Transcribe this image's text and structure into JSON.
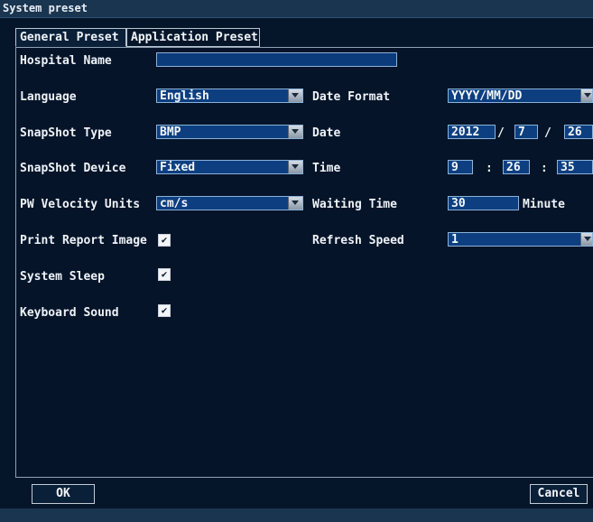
{
  "window": {
    "title": "System preset"
  },
  "tabs": [
    {
      "label": "General Preset",
      "active": true
    },
    {
      "label": "Application Preset",
      "active": false
    }
  ],
  "left": {
    "hospital_name_label": "Hospital Name",
    "hospital_name_value": "",
    "language_label": "Language",
    "language_value": "English",
    "snapshot_type_label": "SnapShot Type",
    "snapshot_type_value": "BMP",
    "snapshot_device_label": "SnapShot Device",
    "snapshot_device_value": "Fixed",
    "pw_velocity_label": "PW Velocity Units",
    "pw_velocity_value": "cm/s",
    "print_report_label": "Print Report Image",
    "print_report_checked": true,
    "system_sleep_label": "System Sleep",
    "system_sleep_checked": true,
    "keyboard_sound_label": "Keyboard Sound",
    "keyboard_sound_checked": true
  },
  "right": {
    "date_format_label": "Date Format",
    "date_format_value": "YYYY/MM/DD",
    "date_label": "Date",
    "date_year": "2012",
    "date_month": "7",
    "date_day": "26",
    "date_sep": "/",
    "time_label": "Time",
    "time_hour": "9",
    "time_minute": "26",
    "time_second": "35",
    "time_sep": ":",
    "waiting_time_label": "Waiting Time",
    "waiting_time_value": "30",
    "waiting_time_unit": "Minute",
    "refresh_speed_label": "Refresh Speed",
    "refresh_speed_value": "1"
  },
  "buttons": {
    "ok": "OK",
    "cancel": "Cancel"
  },
  "colors": {
    "background": "#06162a",
    "field": "#0d3f80",
    "titlebar": "#1a3550"
  }
}
